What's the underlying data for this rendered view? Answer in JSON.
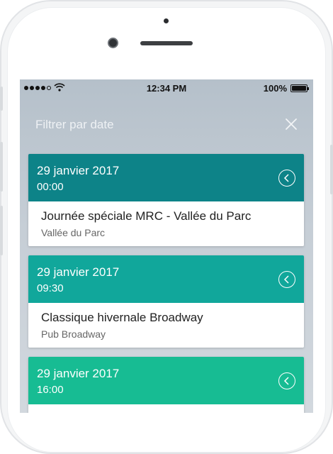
{
  "status_bar": {
    "time": "12:34 PM",
    "battery": "100%"
  },
  "filter": {
    "title": "Filtrer par date",
    "close_icon": "close-icon"
  },
  "events": [
    {
      "date": "29 janvier 2017",
      "time": "00:00",
      "title": "Journée spéciale MRC - Vallée du Parc",
      "venue": "Vallée du Parc",
      "color": "#0d8388"
    },
    {
      "date": "29 janvier 2017",
      "time": "09:30",
      "title": "Classique hivernale Broadway",
      "venue": "Pub Broadway",
      "color": "#11a79b"
    },
    {
      "date": "29 janvier 2017",
      "time": "16:00",
      "title": "",
      "venue": "",
      "color": "#17bc93"
    }
  ]
}
